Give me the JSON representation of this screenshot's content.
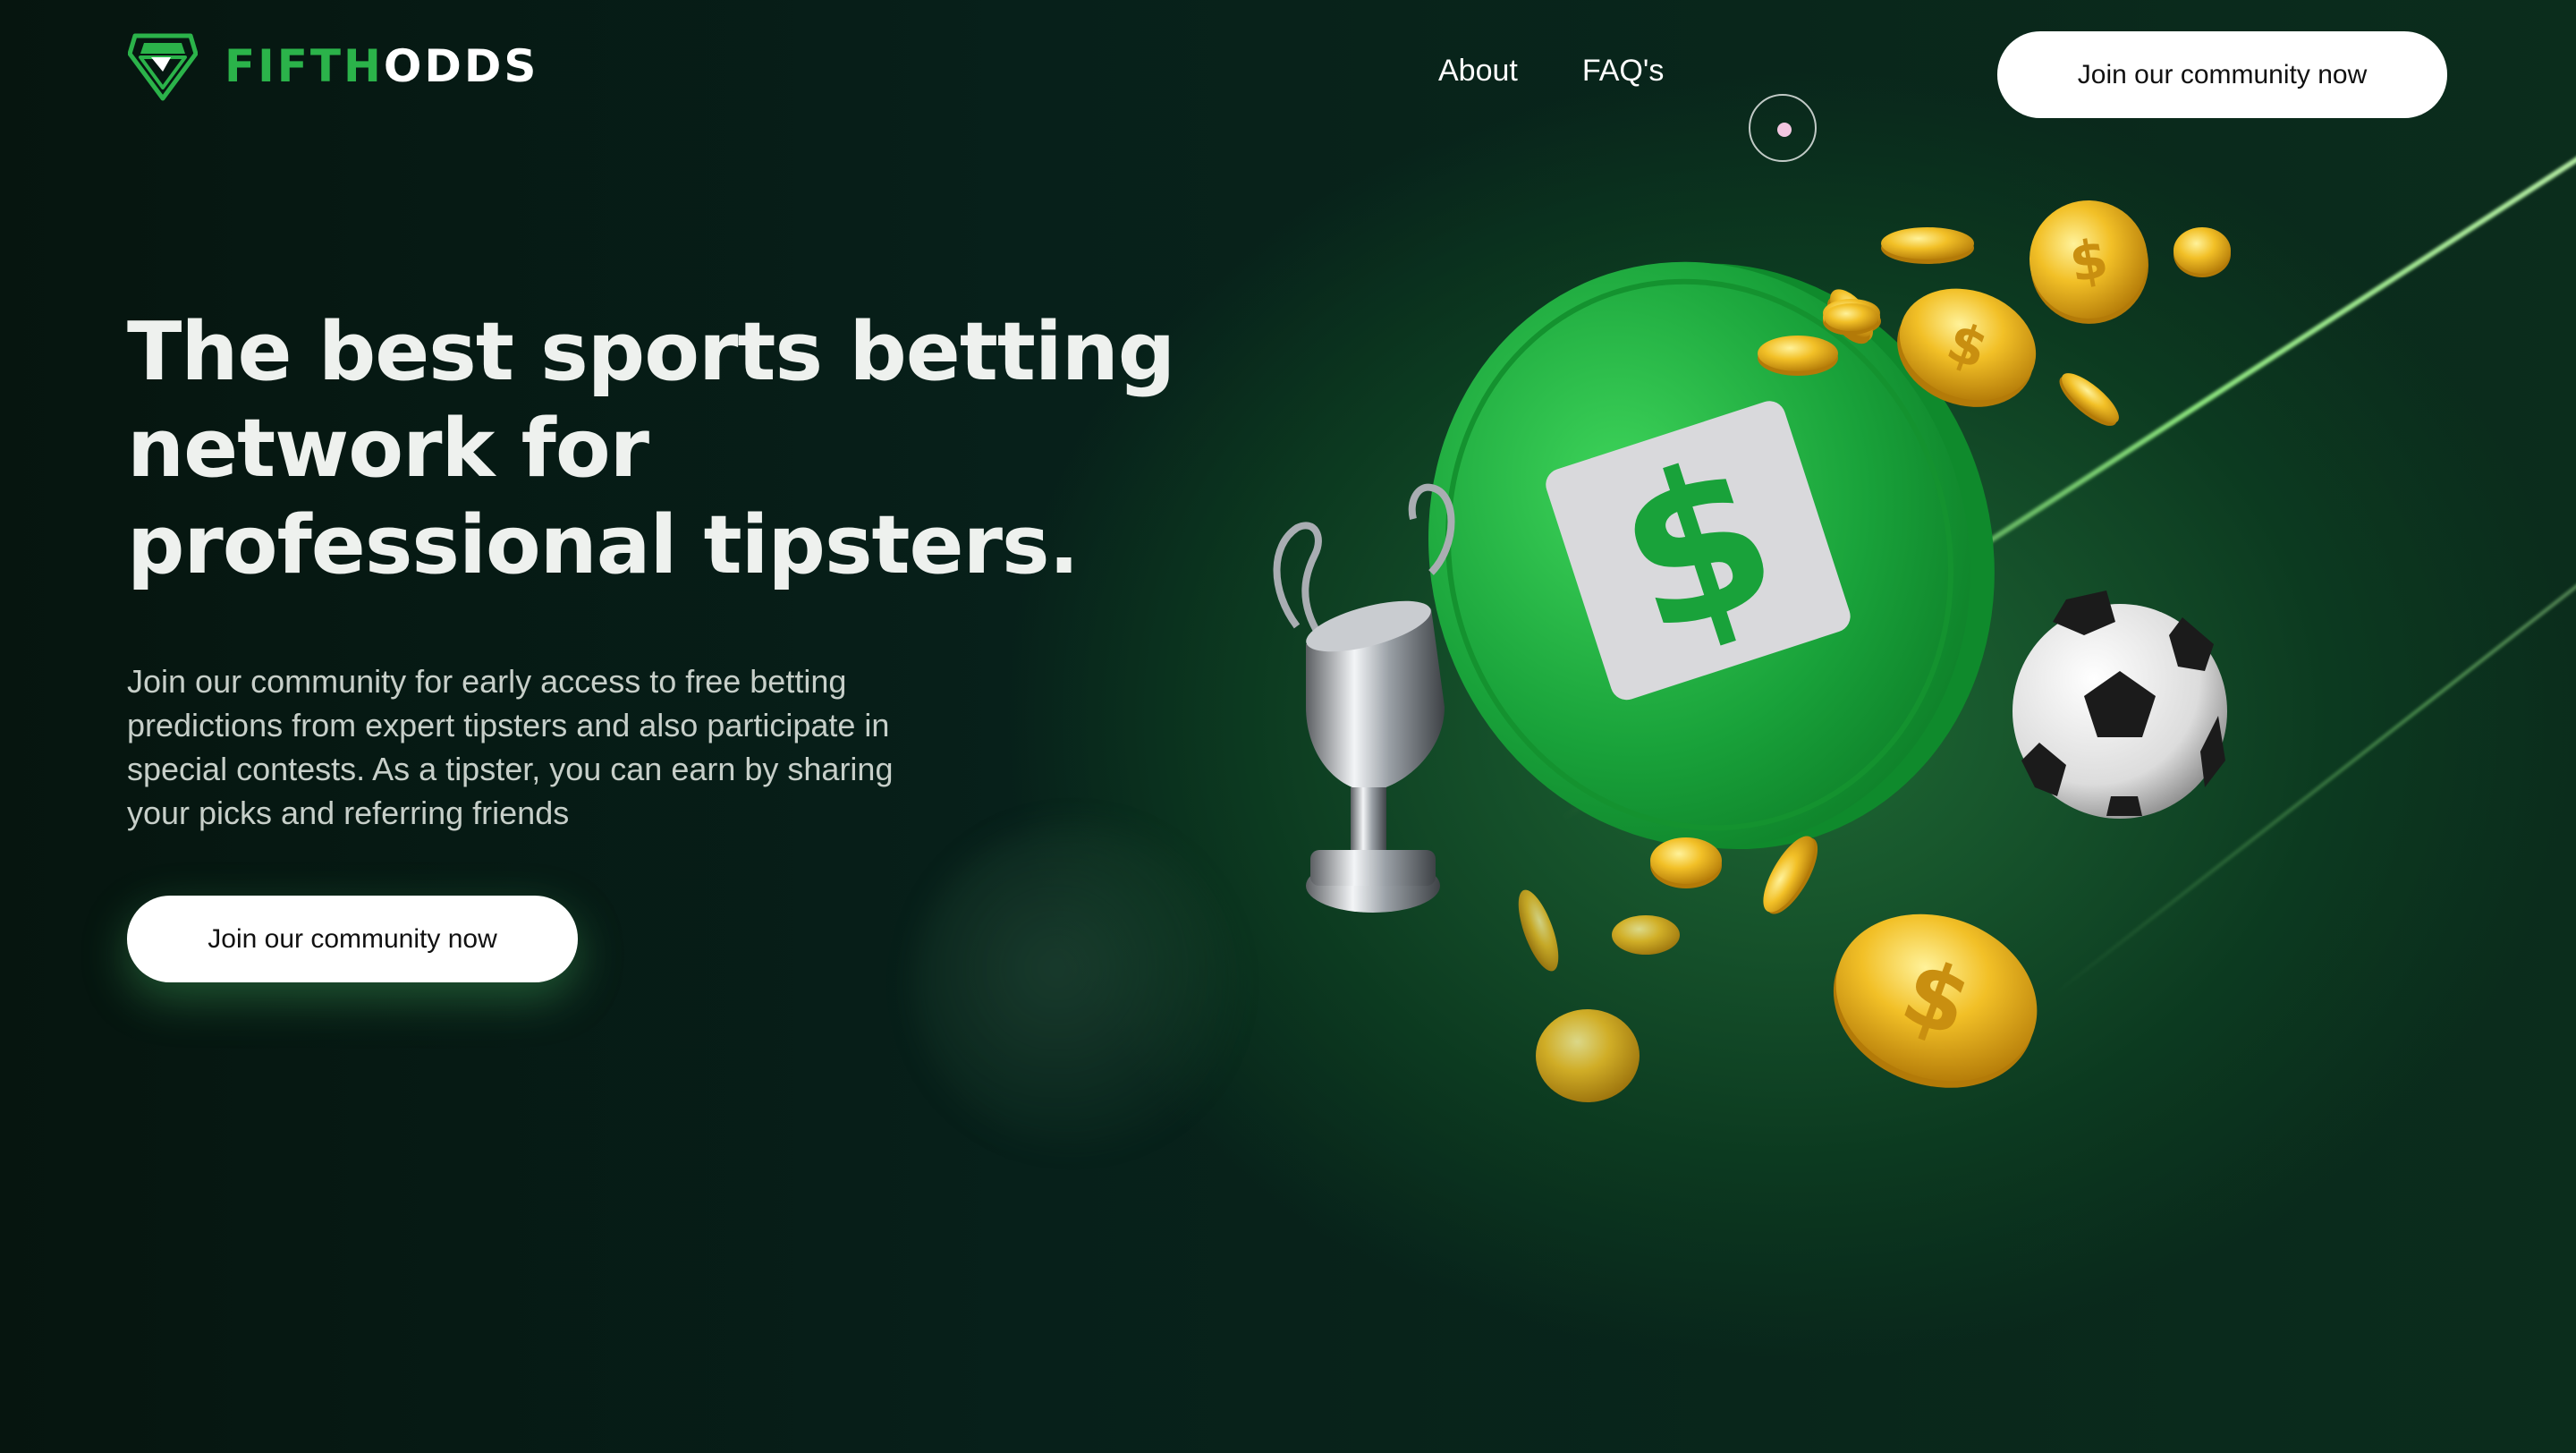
{
  "brand": {
    "name_accent": "FIFTH",
    "name_rest": "ODDS",
    "accent_color": "#2bb34a",
    "logo_icon": "diamond-shield-icon"
  },
  "nav": {
    "items": [
      {
        "label": "About"
      },
      {
        "label": "FAQ's"
      }
    ],
    "cta_label": "Join our community now"
  },
  "hero": {
    "title": "The best sports betting network for professional tipsters.",
    "description": "Join our community for early access to free betting predictions from expert tipsters and also participate in special contests. As a tipster, you can earn by sharing your picks and referring friends",
    "cta_label": "Join our community now"
  },
  "illustration": {
    "elements": [
      "green-dollar-coin",
      "silver-trophy",
      "soccer-ball",
      "gold-coins"
    ]
  },
  "colors": {
    "background": "#071a12",
    "primary_green": "#19a23a",
    "button_bg": "#ffffff",
    "button_text": "#111111",
    "coin_gold": "#f2c027"
  }
}
